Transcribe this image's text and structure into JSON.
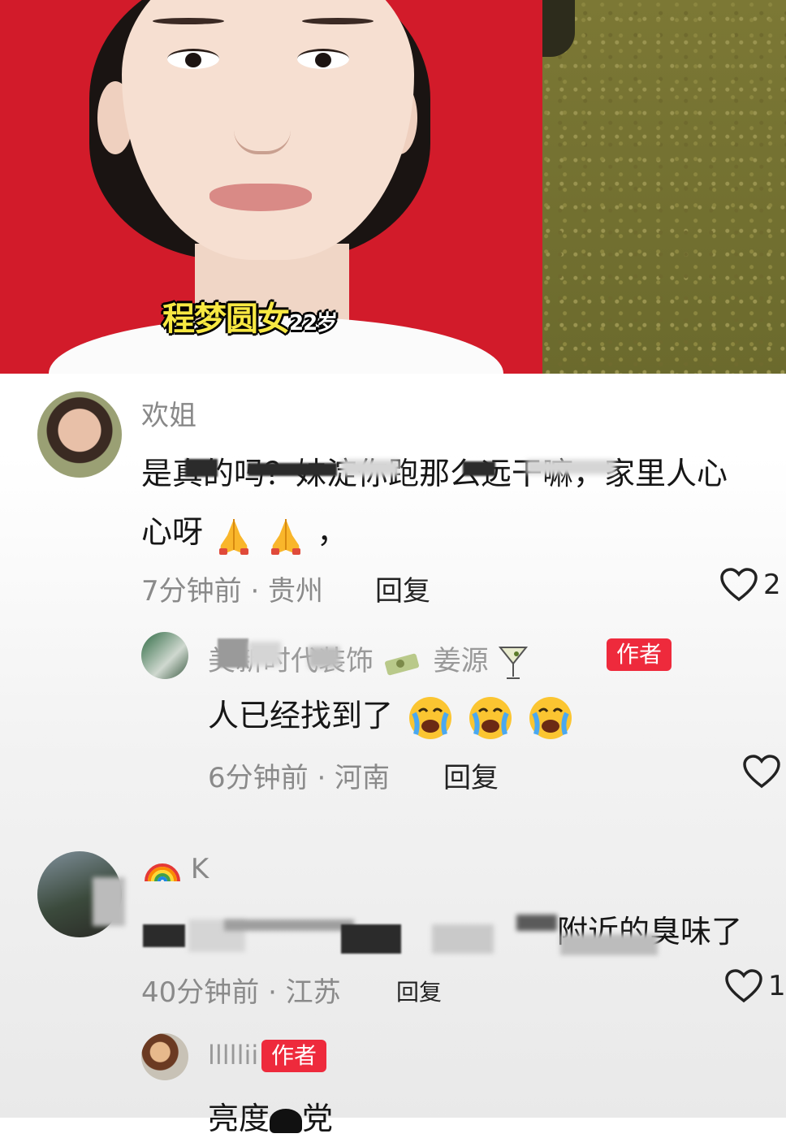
{
  "video": {
    "caption_name": "程梦圆女",
    "caption_age": "22岁"
  },
  "comments": [
    {
      "username": "欢姐",
      "text_line1": "是真的吗？妹淀你跑那么远干嘛，家里人心",
      "text_line2": "心呀",
      "text_tail": "，",
      "time_location": "7分钟前 · 贵州",
      "reply_label": "回复",
      "likes": "2",
      "icons": [
        "folded-hands-icon",
        "folded-hands-icon"
      ],
      "replies": [
        {
          "username": "美新时代装饰",
          "username_suffix": "姜源",
          "badge": "作者",
          "text": "人已经找到了",
          "icons": [
            "crying-face-icon",
            "crying-face-icon",
            "crying-face-icon"
          ],
          "time_location": "6分钟前 · 河南",
          "reply_label": "回复"
        }
      ]
    },
    {
      "username": "K",
      "text_tail": "附近的臭味了",
      "time_location": "40分钟前 · 江苏",
      "reply_label": "回复",
      "likes": "1",
      "replies": [
        {
          "username": "lllllii",
          "badge": "作者",
          "text_start": "亮度",
          "text_end": "党"
        }
      ]
    }
  ],
  "colors": {
    "badge": "#ee2a3c",
    "caption": "#f7e842",
    "background_red": "#d21b2a"
  }
}
